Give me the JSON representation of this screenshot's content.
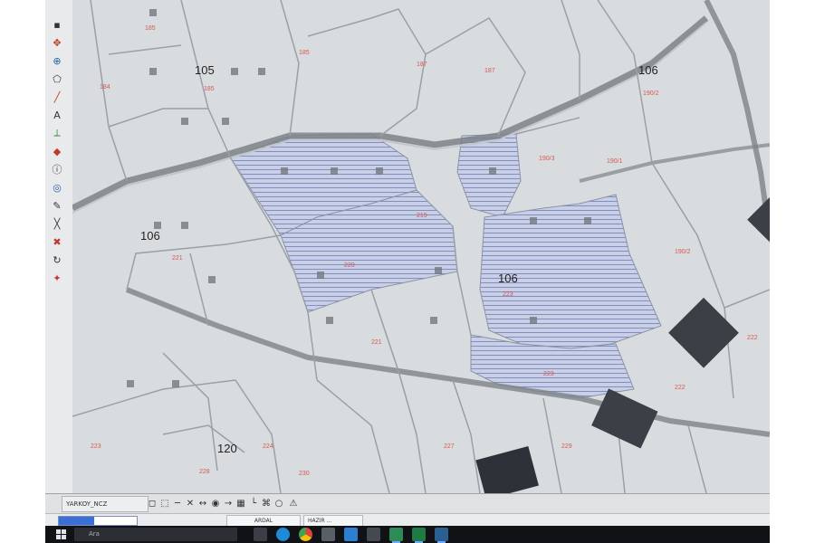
{
  "map": {
    "block_labels": [
      {
        "text": "105"
      },
      {
        "text": "106"
      },
      {
        "text": "106"
      },
      {
        "text": "106"
      },
      {
        "text": "120"
      }
    ],
    "parcel_labels": [
      {
        "text": "185"
      },
      {
        "text": "185"
      },
      {
        "text": "184"
      },
      {
        "text": "185"
      },
      {
        "text": "187"
      },
      {
        "text": "187"
      },
      {
        "text": "190/2"
      },
      {
        "text": "190/3"
      },
      {
        "text": "190/2"
      },
      {
        "text": "190/1"
      },
      {
        "text": "219"
      },
      {
        "text": "220"
      },
      {
        "text": "221"
      },
      {
        "text": "221"
      },
      {
        "text": "223"
      },
      {
        "text": "223"
      },
      {
        "text": "222"
      },
      {
        "text": "222"
      },
      {
        "text": "223"
      },
      {
        "text": "224"
      },
      {
        "text": "227"
      },
      {
        "text": "229"
      },
      {
        "text": "228"
      },
      {
        "text": "230"
      }
    ],
    "colors": {
      "background": "#d9dcdf",
      "parcel_boundary": "#9aa0a6",
      "road": "#7d8388",
      "selected_fill": "#c9cfe6",
      "selected_hatch": "#6f7fb0",
      "parcel_label": "#d8413a",
      "dark_block": "#3b4046"
    }
  },
  "toolbar": {
    "file_name": "YARKOY_NCZ",
    "icons": [
      "select-icon",
      "pan-icon",
      "zoom-icon",
      "polygon-icon",
      "line-icon",
      "text-icon",
      "measure-icon",
      "layer-icon",
      "info-icon",
      "snap-icon",
      "edit-icon",
      "delete-icon"
    ]
  },
  "statusbar": {
    "ardal_label": "ARDAL",
    "hazir_label": "HAZIR ...",
    "progress_fraction": 0.45
  },
  "taskbar": {
    "search_placeholder": "Ara",
    "apps": [
      "task-view-icon",
      "edge-icon",
      "chrome-icon",
      "calendar-icon",
      "mail-icon",
      "photos-icon",
      "cad-app-icon",
      "excel-icon",
      "explorer-icon"
    ]
  }
}
